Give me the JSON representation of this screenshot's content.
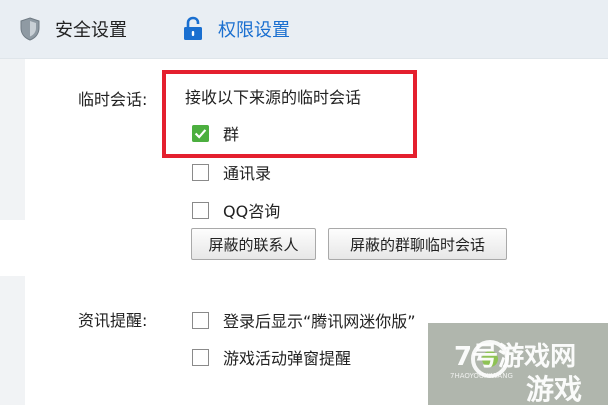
{
  "tabs": [
    {
      "label": "安全设置",
      "icon": "shield-icon"
    },
    {
      "label": "权限设置",
      "icon": "lock-icon"
    }
  ],
  "temp_chat": {
    "section_label": "临时会话:",
    "heading": "接收以下来源的临时会话",
    "options": [
      {
        "label": "群",
        "checked": true
      },
      {
        "label": "通讯录",
        "checked": false
      },
      {
        "label": "QQ咨询",
        "checked": false
      }
    ],
    "buttons": {
      "block_contacts": "屏蔽的联系人",
      "block_group_chats": "屏蔽的群聊临时会话"
    }
  },
  "news": {
    "section_label": "资讯提醒:",
    "options": [
      {
        "label": "登录后显示“腾讯网迷你版”",
        "checked": false
      },
      {
        "label": "游戏活动弹窗提醒",
        "checked": false
      }
    ]
  },
  "watermark": {
    "line1": "7号游戏网",
    "line2": "游戏",
    "small": "7HAOYOUXIWANG"
  },
  "colors": {
    "accent": "#1a6fd0",
    "highlight": "#e4202e",
    "check": "#4caf3f"
  }
}
